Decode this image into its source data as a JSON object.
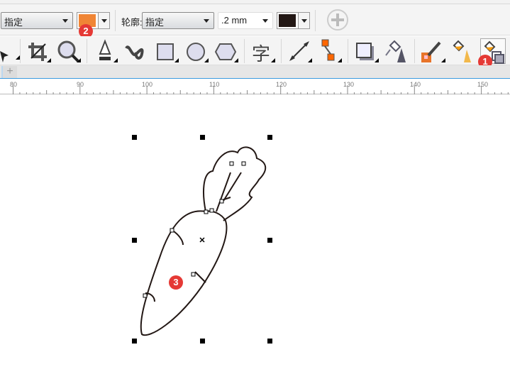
{
  "property_bar": {
    "fill_select": "指定",
    "fill_color": "#f08535",
    "outline_label": "轮廓:",
    "outline_select": "指定",
    "outline_width": ".2 mm",
    "outline_color": "#231815",
    "add_icon": "plus-circle-icon"
  },
  "toolbox": {
    "tools": [
      "pick-tool",
      "crop-tool",
      "zoom-tool",
      "pen-tool",
      "artistic-media-tool",
      "rectangle-tool",
      "ellipse-tool",
      "polygon-tool",
      "text-tool",
      "dimension-tool",
      "connector-tool",
      "drop-shadow-tool",
      "transparency-tool",
      "color-eyedropper-tool",
      "interactive-fill-tool",
      "smart-fill-tool"
    ],
    "text_tool_glyph": "字"
  },
  "tabs": {
    "add_label": "+"
  },
  "ruler": {
    "labels": [
      "80",
      "90",
      "100",
      "110",
      "120",
      "130",
      "140",
      "150"
    ]
  },
  "badges": {
    "b1": "1",
    "b2": "2",
    "b3": "3"
  }
}
